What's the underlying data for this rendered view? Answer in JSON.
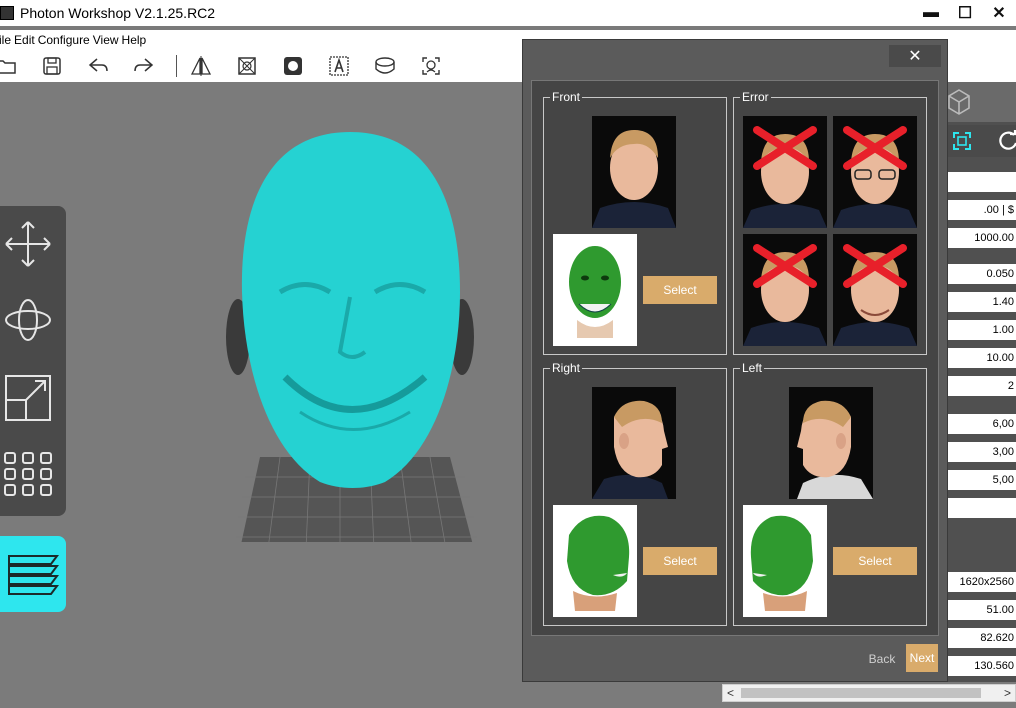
{
  "window": {
    "title": "Photon Workshop V2.1.25.RC2",
    "minimize": "▬",
    "maximize": "☐",
    "close": "✕"
  },
  "menu": {
    "items": [
      {
        "label": "ile"
      },
      {
        "label": "Edit"
      },
      {
        "label": "Configure"
      },
      {
        "label": "View"
      },
      {
        "label": "Help"
      }
    ]
  },
  "toolbar": {
    "icons": [
      "open-folder-icon",
      "save-icon",
      "undo-icon",
      "redo-icon",
      "mirror-icon",
      "hollow-icon",
      "punch-icon",
      "text-icon",
      "base-icon",
      "supports-icon"
    ]
  },
  "left_tools": [
    "move-icon",
    "rotate-icon",
    "scale-icon",
    "arrange-icon",
    "layers-icon"
  ],
  "right_panel": {
    "fields": [
      {
        "value": ""
      },
      {
        "value": ".00 | $"
      },
      {
        "value": "1000.00"
      },
      {
        "value": "0.050"
      },
      {
        "value": "1.40"
      },
      {
        "value": "1.00"
      },
      {
        "value": "10.00"
      },
      {
        "value": "2"
      },
      {
        "value": "6,00"
      },
      {
        "value": "3,00"
      },
      {
        "value": "5,00"
      },
      {
        "value": ""
      },
      {
        "value": "1620x2560"
      },
      {
        "value": "51.00"
      },
      {
        "value": "82.620"
      },
      {
        "value": "130.560"
      }
    ]
  },
  "dialog": {
    "close": "✕",
    "groups": {
      "front": {
        "label": "Front"
      },
      "error": {
        "label": "Error"
      },
      "right": {
        "label": "Right"
      },
      "left": {
        "label": "Left"
      }
    },
    "select_label": "Select",
    "back_label": "Back",
    "next_label": "Next"
  },
  "colors": {
    "accent": "#d9ab6b",
    "model": "#25d2d2",
    "layers_button": "#2ee6ee",
    "error_cross": "#e8202a",
    "mask_green": "#2f9a2f"
  }
}
